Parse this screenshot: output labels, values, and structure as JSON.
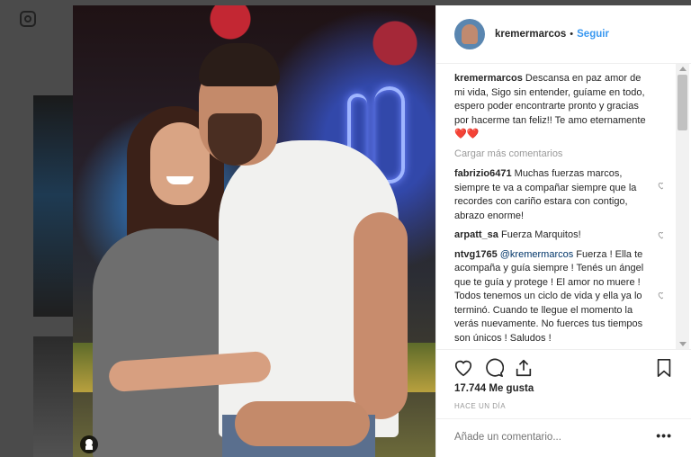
{
  "post": {
    "username": "kremermarcos",
    "separator": "•",
    "follow_label": "Seguir",
    "caption_user": "kremermarcos",
    "caption": "Descansa en paz amor de mi vida, Sigo sin entender, guíame en todo, espero poder encontrarte pronto y gracias por hacerme tan feliz!! Te amo eternamente❤️❤️",
    "load_more": "Cargar más comentarios",
    "comments": [
      {
        "user": "fabrizio6471",
        "text": "Muchas fuerzas marcos, siempre te va a compañar siempre que la recordes con cariño estara con contigo, abrazo enorme!"
      },
      {
        "user": "arpatt_sa",
        "text": "Fuerza Marquitos!"
      },
      {
        "user": "ntvg1765",
        "mention": "@kremermarcos",
        "text": "Fuerza ! Ella te acompaña y guía siempre ! Tenés un ángel que te guía y protege ! El amor no muere ! Todos tenemos un ciclo de vida y ella ya lo terminó. Cuando te llegue el momento la verás nuevamente. No fuerces tus tiempos son únicos ! Saludos !"
      }
    ],
    "likes": "17.744 Me gusta",
    "time": "HACE UN DÍA",
    "add_comment_placeholder": "Añade un comentario...",
    "more_options": "•••"
  },
  "icons": {
    "app_logo": "instagram-icon",
    "like": "heart-icon",
    "comment": "comment-icon",
    "share": "share-icon",
    "save": "bookmark-icon",
    "tag": "user-tag-icon",
    "comment_like": "small-heart-icon"
  },
  "colors": {
    "link": "#3897f0",
    "text": "#262626",
    "muted": "#999999",
    "overlay": "#4b4b4b"
  }
}
